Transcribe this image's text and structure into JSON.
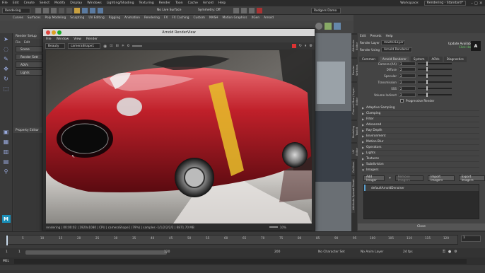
{
  "menubar": {
    "items": [
      "File",
      "Edit",
      "Create",
      "Select",
      "Modify",
      "Display",
      "Windows",
      "Lighting/Shading",
      "Texturing",
      "Render",
      "Toon",
      "Cache",
      "Arnold",
      "Help"
    ],
    "workspace_label": "Workspace:",
    "workspace_value": "Rendering - Standard*"
  },
  "status_line": {
    "mode": "Rendering",
    "live_surface": "No Live Surface",
    "symmetry": "Symmetry: Off",
    "user": "Rodgers Damo"
  },
  "shelf_tabs": [
    "Curves",
    "Surfaces",
    "Poly Modeling",
    "Sculpting",
    "UV Editing",
    "Rigging",
    "Animation",
    "Rendering",
    "FX",
    "FX Caching",
    "Custom",
    "MASH",
    "Motion Graphics",
    "XGen",
    "Arnold"
  ],
  "render_setup": {
    "title": "Render Setup",
    "menu": [
      "File",
      "Edit"
    ],
    "items": [
      "Scene",
      "Render Sett",
      "AOVs",
      "Lights"
    ],
    "property_editor": "Property Editor"
  },
  "renderview": {
    "title": "Arnold RenderView",
    "menu": [
      "File",
      "Window",
      "View",
      "Render"
    ],
    "aov": "Beauty",
    "camera": "cameraShape1",
    "exposure": "0",
    "status": "rendering | 00:00:02 | 1920x1080 | CPU | cameraShape1 (79%) | samples -1/1/2/2/2/2 | 6871.70 MB",
    "zoom": "10%"
  },
  "side_tabs": [
    "Attribute Editor",
    "Render Settings",
    "Channel Box / Layer Editor",
    "Modeling Toolkit",
    "UV Editor",
    "Outliner",
    "Attribute Spread Sheet"
  ],
  "attribute_editor": {
    "menu": [
      "Edit",
      "Presets",
      "Help"
    ],
    "render_layer_label": "Render Layer",
    "render_layer_value": "masterLayer",
    "render_using_label": "Render Using",
    "render_using_value": "Arnold Renderer",
    "update_label": "Update Available",
    "update_link": "Click Here",
    "tabs": [
      "Common",
      "Arnold Renderer",
      "System",
      "AOVs",
      "Diagnostics"
    ],
    "fields": [
      {
        "label": "Camera (AA)",
        "value": "3"
      },
      {
        "label": "Diffuse",
        "value": "2"
      },
      {
        "label": "Specular",
        "value": "2"
      },
      {
        "label": "Transmission",
        "value": "2"
      },
      {
        "label": "SSS",
        "value": "2"
      },
      {
        "label": "Volume Indirect",
        "value": "2"
      }
    ],
    "progressive_label": "Progressive Render",
    "sections": [
      "Adaptive Sampling",
      "Clamping",
      "Filter",
      "Advanced",
      "Ray Depth",
      "Environment",
      "Motion Blur",
      "Lights",
      "Textures",
      "Subdivision",
      "Imagers"
    ],
    "highlight_sections": [
      "Adaptive Sampling",
      "Clamping",
      "Filter",
      "Advanced",
      "Ray Depth",
      "Environment",
      "Motion Blur",
      "Operators",
      "Lights",
      "Textures",
      "Subdivision",
      "Imagers"
    ],
    "add_imager": "Add Imager",
    "remove_imagers": "Remove Imagers",
    "import_imagers": "Import Imagers",
    "export_imagers": "Export Imagers",
    "imager_item": "defaultArnoldDenoiser",
    "close": "Close"
  },
  "timeline": {
    "ticks": [
      "5",
      "10",
      "15",
      "20",
      "25",
      "30",
      "35",
      "40",
      "45",
      "50",
      "55",
      "60",
      "65",
      "70",
      "75",
      "80",
      "85",
      "90",
      "95",
      "100",
      "105",
      "110",
      "115",
      "120"
    ],
    "current_frame": "1"
  },
  "range": {
    "start": "1",
    "start_inner": "1",
    "end_inner": "120",
    "end": "200",
    "character_set": "No Character Set",
    "anim_layer": "No Anim Layer",
    "fps": "24 fps"
  },
  "cmdline": {
    "label": "MEL"
  }
}
